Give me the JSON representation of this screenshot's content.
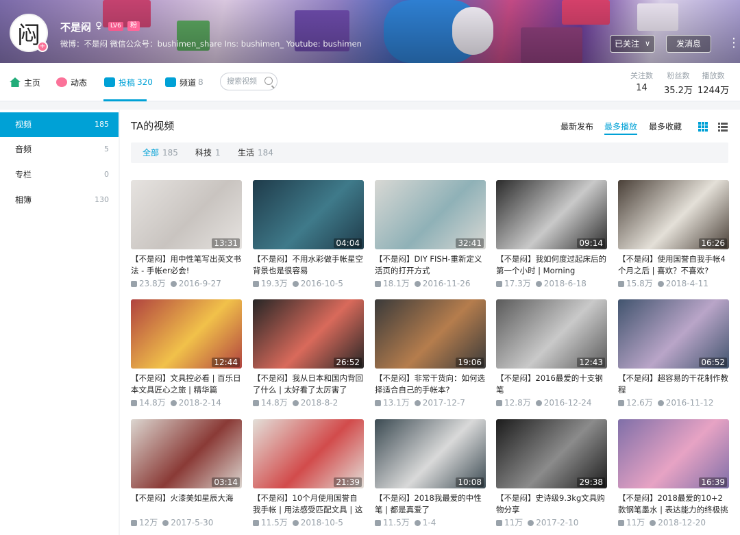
{
  "header": {
    "username": "不是闷",
    "avatar_char": "闷",
    "sex_symbol": "♀",
    "level": "LV6",
    "fan_badge": "粉",
    "sign": "微博：不是闷 微信公众号：bushimen_share Ins: bushimen_ Youtube: bushimen",
    "follow_label": "已关注",
    "message_label": "发消息",
    "more_symbol": "⋮"
  },
  "nav": {
    "items": [
      {
        "label": "主页",
        "count": ""
      },
      {
        "label": "动态",
        "count": ""
      },
      {
        "label": "投稿",
        "count": "320"
      },
      {
        "label": "频道",
        "count": "8"
      }
    ],
    "search_placeholder": "搜索视频",
    "stats": [
      {
        "key": "关注数",
        "value": "14"
      },
      {
        "key": "粉丝数",
        "value": "35.2万"
      },
      {
        "key": "播放数",
        "value": "1244万"
      }
    ]
  },
  "sidebar": {
    "items": [
      {
        "label": "视频",
        "count": "185"
      },
      {
        "label": "音频",
        "count": "5"
      },
      {
        "label": "专栏",
        "count": "0"
      },
      {
        "label": "相簿",
        "count": "130"
      }
    ]
  },
  "main": {
    "title": "TA的视频",
    "sort": [
      "最新发布",
      "最多播放",
      "最多收藏"
    ],
    "filters": [
      {
        "label": "全部",
        "count": "185"
      },
      {
        "label": "科技",
        "count": "1"
      },
      {
        "label": "生活",
        "count": "184"
      }
    ],
    "videos": [
      {
        "title": "【不是闷】用中性笔写出英文书法 - 手帐er必会!",
        "plays": "23.8万",
        "date": "2016-9-27",
        "duration": "13:31",
        "bg": "#e6e3e0",
        "fg": "#c9c4c0",
        "overlay": ""
      },
      {
        "title": "【不是闷】不用水彩做手帐星空背景也是很容易",
        "plays": "19.3万",
        "date": "2016-10-5",
        "duration": "04:04",
        "bg": "#1f3b4a",
        "fg": "#3f7a8a",
        "overlay": ""
      },
      {
        "title": "【不是闷】DIY FISH-重新定义活页的打开方式",
        "plays": "18.1万",
        "date": "2016-11-26",
        "duration": "32:41",
        "bg": "#d8d8d4",
        "fg": "#8fb1b7",
        "overlay": ""
      },
      {
        "title": "【不是闷】我如何度过起床后的第一个小时 | Morning",
        "plays": "17.3万",
        "date": "2018-6-18",
        "duration": "09:14",
        "bg": "#2b2b2b",
        "fg": "#c9c9c9",
        "overlay": ""
      },
      {
        "title": "【不是闷】使用国誉自我手帐4个月之后 | 喜欢？不喜欢?",
        "plays": "15.8万",
        "date": "2018-4-11",
        "duration": "16:26",
        "bg": "#4a4038",
        "fg": "#e4e0d8",
        "overlay": ""
      },
      {
        "title": "【不是闷】文具控必看 | 百乐日本文具匠心之旅 | 精华篇",
        "plays": "14.8万",
        "date": "2018-2-14",
        "duration": "12:44",
        "bg": "#b0423f",
        "fg": "#f1c14a",
        "overlay": ""
      },
      {
        "title": "【不是闷】我从日本和国内背回了什么 | 太好看了太厉害了",
        "plays": "14.8万",
        "date": "2018-8-2",
        "duration": "26:52",
        "bg": "#262626",
        "fg": "#d96a5b",
        "overlay": ""
      },
      {
        "title": "【不是闷】非常干货向：如何选择适合自己的手帐本?",
        "plays": "13.1万",
        "date": "2017-12-7",
        "duration": "19:06",
        "bg": "#3a3a3a",
        "fg": "#b57d4d",
        "overlay": ""
      },
      {
        "title": "【不是闷】2016最爱的十支钢笔",
        "plays": "12.8万",
        "date": "2016-12-24",
        "duration": "12:43",
        "bg": "#5a5a5a",
        "fg": "#c9c9c9",
        "overlay": ""
      },
      {
        "title": "【不是闷】超容易的干花制作教程",
        "plays": "12.6万",
        "date": "2016-11-12",
        "duration": "06:52",
        "bg": "#41546e",
        "fg": "#b9a5c8",
        "overlay": ""
      },
      {
        "title": "【不是闷】火漆美如星辰大海",
        "plays": "12万",
        "date": "2017-5-30",
        "duration": "03:14",
        "bg": "#dcd6d0",
        "fg": "#8a3a36",
        "overlay": ""
      },
      {
        "title": "【不是闷】10个月使用国誉自我手帐 | 用法感受匹配文具 | 这",
        "plays": "11.5万",
        "date": "2018-10-5",
        "duration": "21:39",
        "bg": "#e3dfd9",
        "fg": "#d24b4b",
        "overlay": ""
      },
      {
        "title": "【不是闷】2018我最爱的中性笔 | 都是真爱了",
        "plays": "11.5万",
        "date": "1-4",
        "duration": "10:08",
        "bg": "#3b4a52",
        "fg": "#d9d9d9",
        "overlay": ""
      },
      {
        "title": "【不是闷】史诗级9.3kg文具购物分享",
        "plays": "11万",
        "date": "2017-2-10",
        "duration": "29:38",
        "bg": "#1c1c1c",
        "fg": "#8b8b8b",
        "overlay": ""
      },
      {
        "title": "【不是闷】2018最爱的10+2款钢笔墨水 | 表达能力的终极挑",
        "plays": "11万",
        "date": "2018-12-20",
        "duration": "16:39",
        "bg": "#7f6fa8",
        "fg": "#e7a3c4",
        "overlay": ""
      }
    ]
  }
}
